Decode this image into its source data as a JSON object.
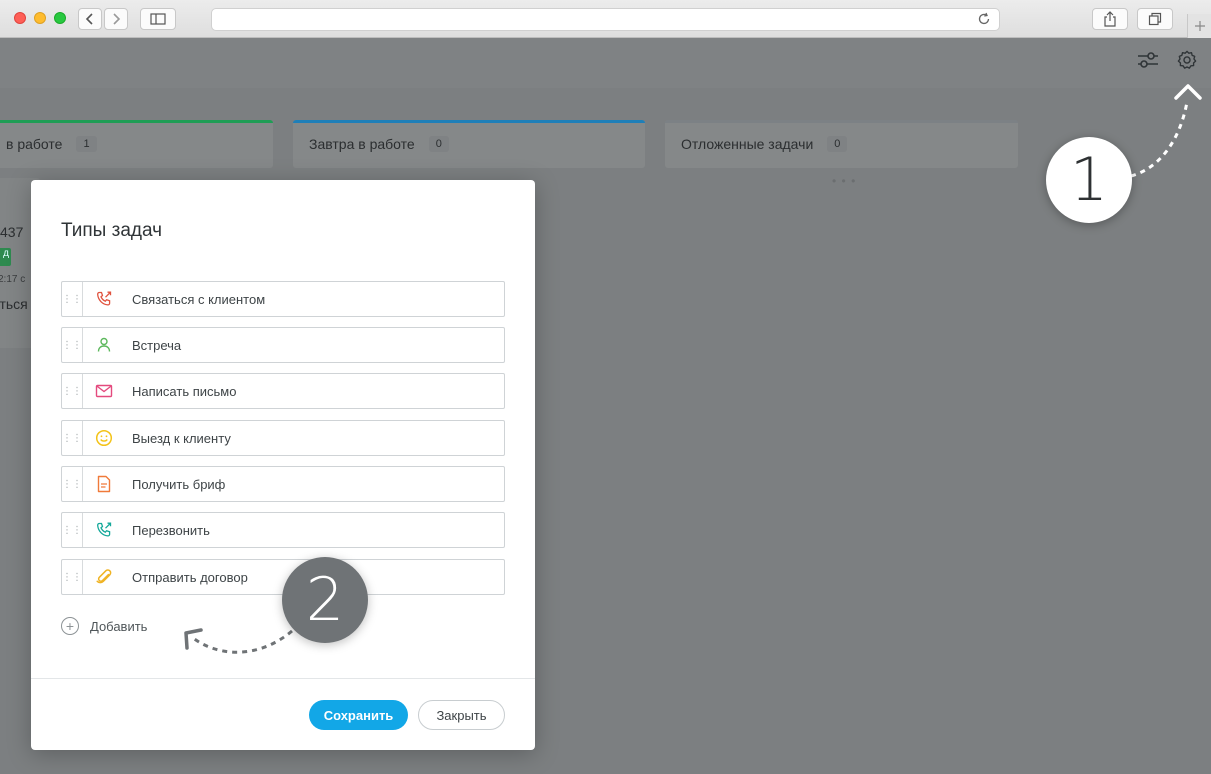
{
  "browser": {
    "url": "",
    "icons": {
      "back": "chevron-left-icon",
      "forward": "chevron-right-icon",
      "sidebar": "sidebar-icon",
      "reload": "reload-icon",
      "share": "share-icon",
      "tabs": "tabs-icon",
      "new_tab": "plus-icon"
    }
  },
  "toolbar": {
    "filter_icon": "sliders-icon",
    "settings_icon": "gear-icon"
  },
  "board": {
    "columns": [
      {
        "title": "в работе",
        "count": "1",
        "accent": "#1f9d55"
      },
      {
        "title": "Завтра в работе",
        "count": "0",
        "accent": "#1f7fb8"
      },
      {
        "title": "Отложенные задачи",
        "count": "0",
        "accent": "#7c8185"
      }
    ],
    "card_fragment": {
      "number": "437",
      "badge": "д",
      "time": "2:17 с",
      "text": "аться"
    }
  },
  "modal": {
    "title": "Типы задач",
    "task_types": [
      {
        "label": "Связаться с клиентом",
        "icon": "phone-outgoing-icon",
        "color": "#e0533f"
      },
      {
        "label": "Встреча",
        "icon": "person-icon",
        "color": "#5cb85c"
      },
      {
        "label": "Написать письмо",
        "icon": "mail-icon",
        "color": "#e44a7e"
      },
      {
        "label": "Выезд к клиенту",
        "icon": "smile-icon",
        "color": "#f3c319"
      },
      {
        "label": "Получить бриф",
        "icon": "document-icon",
        "color": "#f07a3a"
      },
      {
        "label": "Перезвонить",
        "icon": "phone-callback-icon",
        "color": "#14a89a"
      },
      {
        "label": "Отправить договор",
        "icon": "paperclip-icon",
        "color": "#f0b323"
      }
    ],
    "add_label": "Добавить",
    "save_label": "Сохранить",
    "close_label": "Закрыть"
  },
  "callouts": {
    "first": "1",
    "second": "2"
  }
}
